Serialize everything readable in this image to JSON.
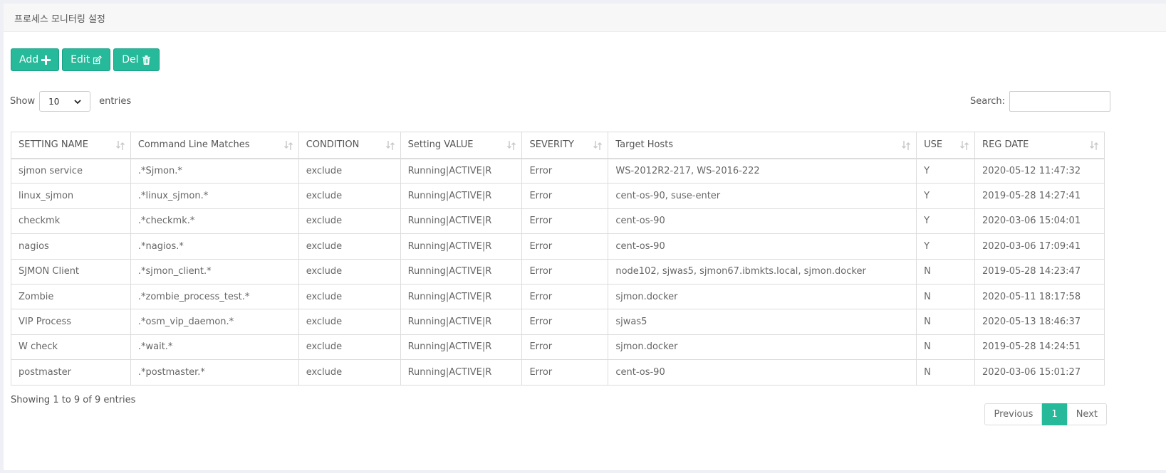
{
  "panel": {
    "title": "프로세스 모니터링 설정"
  },
  "toolbar": {
    "add_label": "Add",
    "edit_label": "Edit",
    "del_label": "Del"
  },
  "length": {
    "show_label": "Show",
    "selected": "10",
    "entries_label": "entries"
  },
  "search": {
    "label": "Search:",
    "value": ""
  },
  "table": {
    "columns": [
      "SETTING NAME",
      "Command Line Matches",
      "CONDITION",
      "Setting VALUE",
      "SEVERITY",
      "Target Hosts",
      "USE",
      "REG DATE"
    ],
    "rows": [
      [
        "sjmon service",
        ".*Sjmon.*",
        "exclude",
        "Running|ACTIVE|R",
        "Error",
        "WS-2012R2-217, WS-2016-222",
        "Y",
        "2020-05-12 11:47:32"
      ],
      [
        "linux_sjmon",
        ".*linux_sjmon.*",
        "exclude",
        "Running|ACTIVE|R",
        "Error",
        "cent-os-90, suse-enter",
        "Y",
        "2019-05-28 14:27:41"
      ],
      [
        "checkmk",
        ".*checkmk.*",
        "exclude",
        "Running|ACTIVE|R",
        "Error",
        "cent-os-90",
        "Y",
        "2020-03-06 15:04:01"
      ],
      [
        "nagios",
        ".*nagios.*",
        "exclude",
        "Running|ACTIVE|R",
        "Error",
        "cent-os-90",
        "Y",
        "2020-03-06 17:09:41"
      ],
      [
        "SJMON Client",
        ".*sjmon_client.*",
        "exclude",
        "Running|ACTIVE|R",
        "Error",
        "node102, sjwas5, sjmon67.ibmkts.local, sjmon.docker",
        "N",
        "2019-05-28 14:23:47"
      ],
      [
        "Zombie",
        ".*zombie_process_test.*",
        "exclude",
        "Running|ACTIVE|R",
        "Error",
        "sjmon.docker",
        "N",
        "2020-05-11 18:17:58"
      ],
      [
        "VIP Process",
        ".*osm_vip_daemon.*",
        "exclude",
        "Running|ACTIVE|R",
        "Error",
        "sjwas5",
        "N",
        "2020-05-13 18:46:37"
      ],
      [
        "W check",
        ".*wait.*",
        "exclude",
        "Running|ACTIVE|R",
        "Error",
        "sjmon.docker",
        "N",
        "2019-05-28 14:24:51"
      ],
      [
        "postmaster",
        ".*postmaster.*",
        "exclude",
        "Running|ACTIVE|R",
        "Error",
        "cent-os-90",
        "N",
        "2020-03-06 15:01:27"
      ]
    ]
  },
  "info": "Showing 1 to 9 of 9 entries",
  "pagination": {
    "previous": "Previous",
    "current": "1",
    "next": "Next"
  },
  "colors": {
    "accent": "#26b99a",
    "accent_border": "#169f85"
  },
  "icons": {
    "add": "plus-icon",
    "edit": "edit-icon",
    "del": "trash-icon",
    "sort": "sort-icon"
  }
}
